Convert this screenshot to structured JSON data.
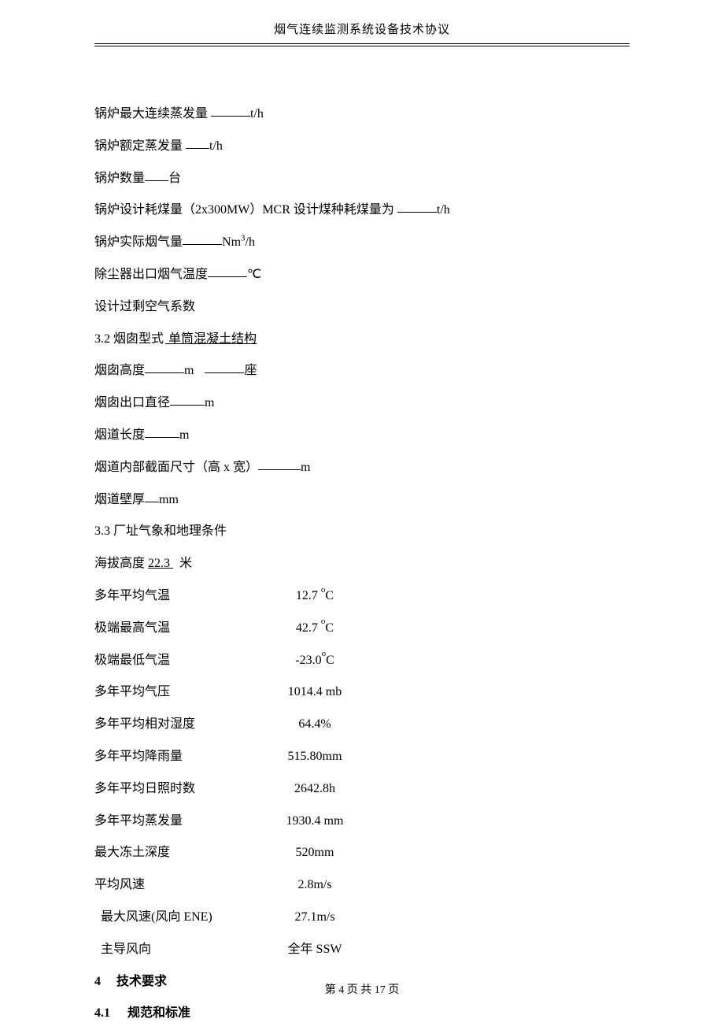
{
  "header": {
    "title": "烟气连续监测系统设备技术协议"
  },
  "lines": {
    "l1_a": "锅炉最大连续蒸发量 ",
    "l1_b": "t/h",
    "l2_a": "锅炉额定蒸发量 ",
    "l2_b": "t/h",
    "l3_a": "锅炉数量",
    "l3_b": "台",
    "l4_a": "锅炉设计耗煤量（2x300MW）MCR 设计煤种耗煤量为 ",
    "l4_b": "t/h",
    "l5_a": "锅炉实际烟气量",
    "l5_b": "Nm",
    "l5_c": "/h",
    "l6_a": "除尘器出口烟气温度",
    "l6_b": "℃",
    "l7": "设计过剩空气系数",
    "l8_a": "3.2  烟囱型式",
    "l8_b": " 单筒混凝土结构",
    "l9_a": "烟囱高度",
    "l9_b": "m",
    "l9_c": "座",
    "l10_a": "烟囱出口直径",
    "l10_b": "m",
    "l11_a": "烟道长度",
    "l11_b": "m",
    "l12_a": "烟道内部截面尺寸（高 x 宽）",
    "l12_b": "m",
    "l13_a": "烟道壁厚",
    "l13_b": "mm",
    "l14": "3.3  厂址气象和地理条件",
    "l15_a": "海拔高度 ",
    "l15_b": " 22.3 ",
    "l15_c": "米"
  },
  "rows": [
    {
      "label": "多年平均气温",
      "value": "12.7 ",
      "unit_type": "degc",
      "indent": false
    },
    {
      "label": "极端最高气温",
      "value": "42.7 ",
      "unit_type": "degc",
      "indent": false
    },
    {
      "label": "极端最低气温",
      "value": "-23.0",
      "unit_type": "degc",
      "indent": false
    },
    {
      "label": "多年平均气压",
      "value": "1014.4 mb",
      "unit_type": "plain",
      "indent": false
    },
    {
      "label": "多年平均相对湿度",
      "value": "64.4%",
      "unit_type": "plain",
      "indent": false
    },
    {
      "label": "多年平均降雨量",
      "value": "515.80mm",
      "unit_type": "plain",
      "indent": false
    },
    {
      "label": "多年平均日照时数",
      "value": "2642.8h",
      "unit_type": "plain",
      "indent": false
    },
    {
      "label": "多年平均蒸发量",
      "value": "1930.4 mm",
      "unit_type": "plain",
      "indent": false
    },
    {
      "label": "最大冻土深度",
      "value": "520mm",
      "unit_type": "plain",
      "indent": false
    },
    {
      "label": "平均风速",
      "value": "2.8m/s",
      "unit_type": "plain",
      "indent": false
    },
    {
      "label": "最大风速(风向 ENE)",
      "value": "27.1m/s",
      "unit_type": "plain",
      "indent": true
    },
    {
      "label": "主导风向",
      "value": "全年 SSW",
      "unit_type": "plain",
      "indent": true
    }
  ],
  "sections": {
    "s4_num": "4",
    "s4_title": "技术要求",
    "s41_num": "4.1",
    "s41_title": "规范和标准"
  },
  "footer": {
    "text": "第 4 页 共 17 页"
  }
}
